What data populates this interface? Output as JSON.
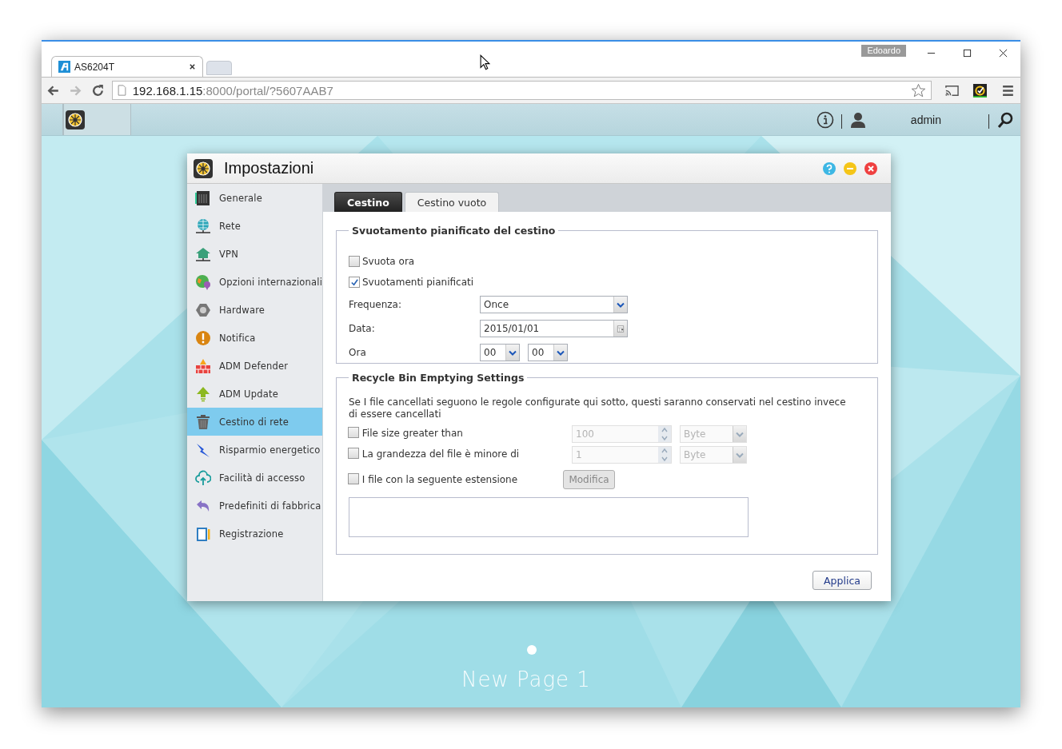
{
  "browser": {
    "tab_title": "AS6204T",
    "url_host": "192.168.1.15",
    "url_rest": ":8000/portal/?5607AAB7",
    "profile": "Edoardo"
  },
  "adm_bar": {
    "user": "admin"
  },
  "dialog": {
    "title": "Impostazioni",
    "sidebar": [
      {
        "label": "Generale",
        "selected": false
      },
      {
        "label": "Rete",
        "selected": false
      },
      {
        "label": "VPN",
        "selected": false
      },
      {
        "label": "Opzioni internazionali",
        "selected": false
      },
      {
        "label": "Hardware",
        "selected": false
      },
      {
        "label": "Notifica",
        "selected": false
      },
      {
        "label": "ADM Defender",
        "selected": false
      },
      {
        "label": "ADM Update",
        "selected": false
      },
      {
        "label": "Cestino di rete",
        "selected": true
      },
      {
        "label": "Risparmio energetico",
        "selected": false
      },
      {
        "label": "Facilità di accesso",
        "selected": false
      },
      {
        "label": "Predefiniti di fabbrica",
        "selected": false
      },
      {
        "label": "Registrazione",
        "selected": false
      }
    ],
    "tabs": [
      {
        "label": "Cestino",
        "selected": true
      },
      {
        "label": "Cestino vuoto",
        "selected": false
      }
    ],
    "schedule": {
      "legend": "Svuotamento pianificato del cestino",
      "checkboxes": [
        {
          "label": "Svuota ora",
          "checked": false
        },
        {
          "label": "Svuotamenti pianificati",
          "checked": true
        }
      ],
      "frequency": {
        "label": "Frequenza:",
        "value": "Once"
      },
      "date": {
        "label": "Data:",
        "value": "2015/01/01"
      },
      "time": {
        "label": "Ora",
        "hours": "00",
        "minutes": "00"
      }
    },
    "rules": {
      "legend": "Recycle Bin Emptying Settings",
      "description": "Se I file cancellati seguono le regole configurate qui sotto, questi saranno conservati nel cestino invece di essere cancellati",
      "items": [
        {
          "kind": "size",
          "label": "File size greater than",
          "checked": false,
          "value": "100",
          "unit": "Byte",
          "disabled": true
        },
        {
          "kind": "size",
          "label": "La grandezza del file è minore di",
          "checked": false,
          "value": "1",
          "unit": "Byte",
          "disabled": true
        },
        {
          "kind": "extension",
          "label": "I file con la seguente estensione",
          "checked": false,
          "button": "Modifica",
          "disabled": true
        }
      ]
    },
    "apply": "Applica"
  },
  "desktop": {
    "page_title": "New Page 1"
  }
}
